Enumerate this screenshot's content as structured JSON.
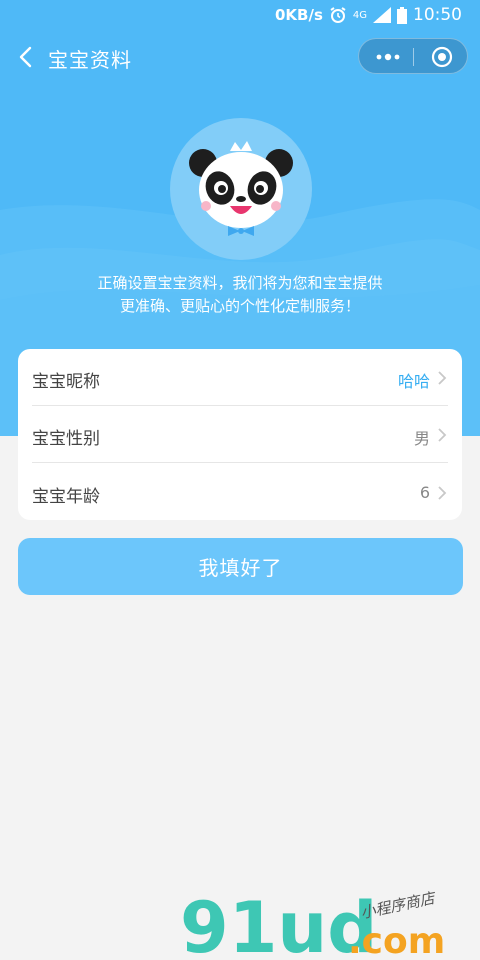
{
  "status_bar": {
    "speed": "0KB/s",
    "network": "4G",
    "time": "10:50"
  },
  "nav": {
    "title": "宝宝资料"
  },
  "intro": {
    "line1": "正确设置宝宝资料，我们将为您和宝宝提供",
    "line2": "更准确、更贴心的个性化定制服务！"
  },
  "profile": {
    "rows": [
      {
        "label": "宝宝昵称",
        "value": "哈哈"
      },
      {
        "label": "宝宝性别",
        "value": "男"
      },
      {
        "label": "宝宝年龄",
        "value": "6"
      }
    ]
  },
  "submit_label": "我填好了",
  "watermark": {
    "brand": "91ud",
    "domain": ".com",
    "tagline": "小程序商店"
  },
  "colors": {
    "primary": "#4fb9f7",
    "button": "#6cc6fb",
    "accent_text": "#37aef2",
    "background": "#f3f3f3"
  }
}
